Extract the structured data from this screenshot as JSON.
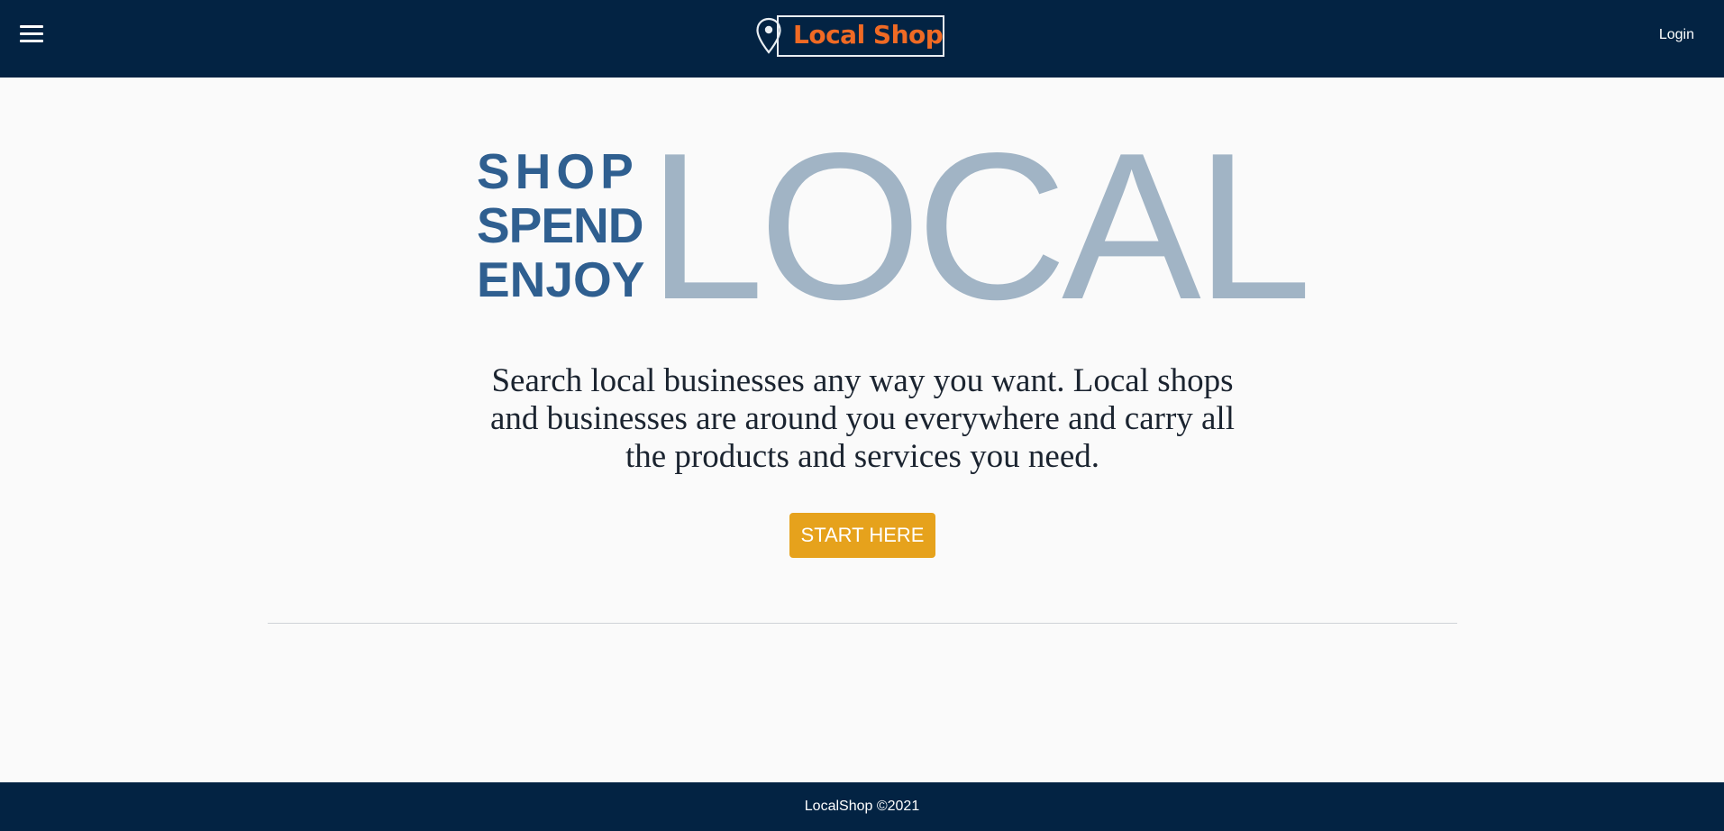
{
  "header": {
    "menu_icon": "hamburger-menu-icon",
    "logo": {
      "icon": "location-pin-icon",
      "text": "Local Shop",
      "text_color": "#f06a24"
    },
    "login_label": "Login",
    "background": "#032343"
  },
  "hero": {
    "stack_words": [
      "SHOP",
      "SPEND",
      "ENJOY"
    ],
    "big_word": "LOCAL",
    "tagline": "Search local businesses any way you want. Local shops and businesses are around you everywhere and carry all the products and services you need.",
    "cta_label": "START HERE",
    "colors": {
      "stack": "#2f5f90",
      "big_word": "#a1b4c5",
      "cta": "#e6a21c"
    }
  },
  "footer": {
    "text": "LocalShop ©2021"
  }
}
